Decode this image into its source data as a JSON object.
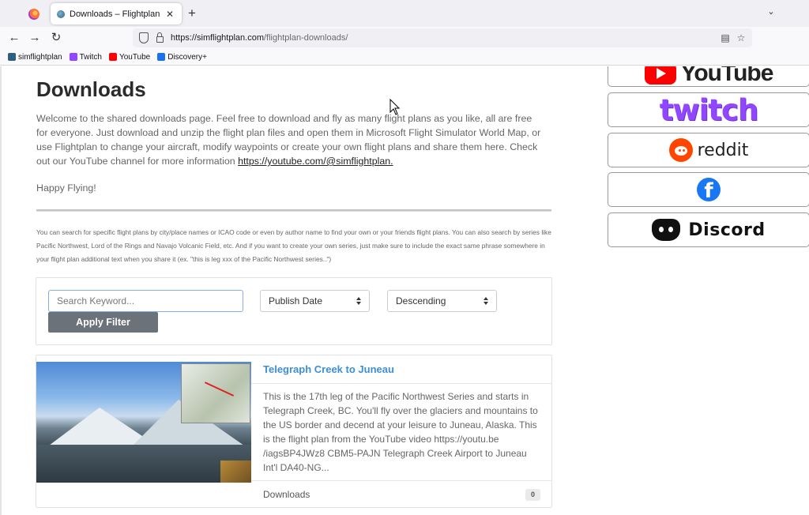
{
  "browser": {
    "tab_title": "Downloads – Flightplan",
    "tab_close": "✕",
    "new_tab": "+",
    "tab_list": "⌄",
    "url_host": "https://simflightplan.com",
    "url_path": "/flightplan-downloads/",
    "nav_back": "←",
    "nav_forward": "→",
    "nav_reload": "↻",
    "reader_icon": "▤",
    "bookmark_star": "☆",
    "bookmarks": [
      {
        "label": "simflightplan",
        "icon": "globe-icon",
        "color": "#2c5f80"
      },
      {
        "label": "Twitch",
        "icon": "twitch-icon",
        "color": "#9146ff"
      },
      {
        "label": "YouTube",
        "icon": "youtube-icon",
        "color": "#ff0000"
      },
      {
        "label": "Discovery+",
        "icon": "discovery-icon",
        "color": "#1b6ff3"
      }
    ]
  },
  "page": {
    "title": "Downloads",
    "intro": "Welcome to the shared downloads page. Feel free to download and fly as many flight plans as you like, all are free for everyone. Just download and unzip the flight plan files and open them in Microsoft Flight Simulator World Map, or use Flightplan to change your aircraft, modify waypoints or create your own flight plans and share them here. Check out our YouTube channel for more information ",
    "intro_link": "https://youtube.com/@simflightplan.",
    "happy": "Happy Flying!",
    "search_help": "You can search for specific flight plans by city/place names or ICAO code or even by author name to find your own or your friends flight plans. You can also search by series like Pacific Northwest, Lord of the Rings and Navajo Volcanic Field, etc. And if you want to create your own series, just make sure to include the exact same phrase somewhere in your flight plan additional text when you share it (ex. \"this is leg xxx of the Pacific Northwest series..\")"
  },
  "filter": {
    "search_placeholder": "Search Keyword...",
    "search_value": "",
    "apply_label": "Apply Filter",
    "sort_by": "Publish Date",
    "sort_order": "Descending"
  },
  "cards": [
    {
      "title": "Telegraph Creek to Juneau",
      "description": "This is the 17th leg of the Pacific Northwest Series and starts in Telegraph Creek, BC. You'll fly over the glaciers and mountains to the US border and decend at your leisure to Juneau, Alaska. This is the flight plan from the YouTube video https://youtu.be /iagsBP4JWz8 CBM5-PAJN Telegraph Creek Airport to Juneau Int'l DA40-NG...",
      "downloads_label": "Downloads",
      "downloads_count": "0"
    }
  ],
  "social": {
    "youtube_text": "YouTube",
    "twitch_text": "twitch",
    "reddit_text": "reddit",
    "facebook_glyph": "f",
    "discord_text": "Discord"
  }
}
